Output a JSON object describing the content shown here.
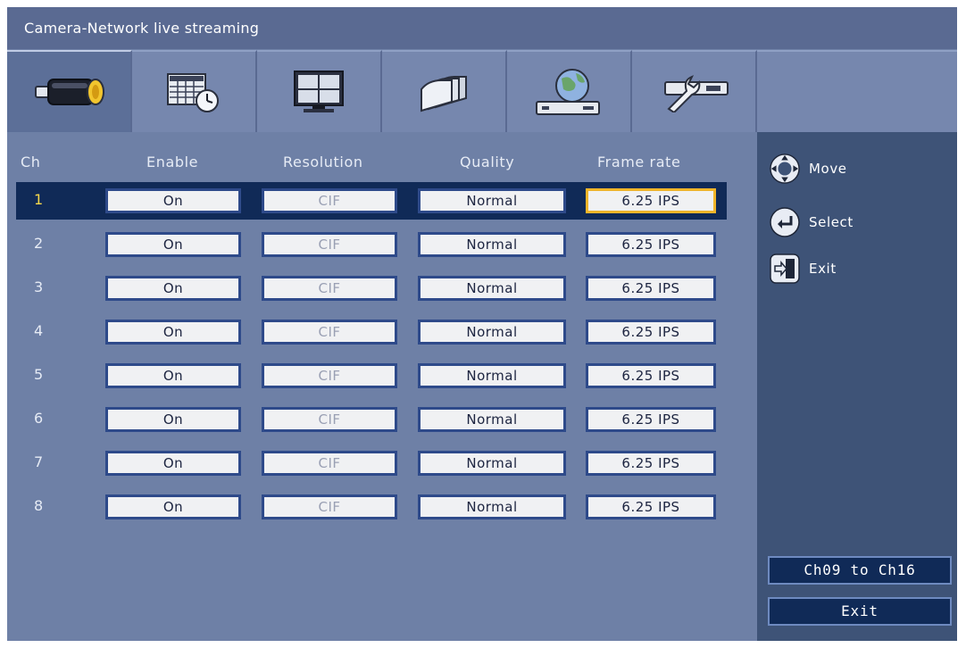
{
  "window": {
    "title": "Camera-Network live streaming"
  },
  "tabs": [
    {
      "icon": "camera-icon",
      "active": true
    },
    {
      "icon": "schedule-icon",
      "active": false
    },
    {
      "icon": "monitor-icon",
      "active": false
    },
    {
      "icon": "disk-stack-icon",
      "active": false
    },
    {
      "icon": "network-globe-icon",
      "active": false
    },
    {
      "icon": "tools-icon",
      "active": false
    }
  ],
  "table": {
    "headers": {
      "ch": "Ch",
      "enable": "Enable",
      "resolution": "Resolution",
      "quality": "Quality",
      "frame_rate": "Frame rate"
    },
    "rows": [
      {
        "ch": "1",
        "enable": "On",
        "resolution": "CIF",
        "quality": "Normal",
        "frame_rate": "6.25 IPS"
      },
      {
        "ch": "2",
        "enable": "On",
        "resolution": "CIF",
        "quality": "Normal",
        "frame_rate": "6.25 IPS"
      },
      {
        "ch": "3",
        "enable": "On",
        "resolution": "CIF",
        "quality": "Normal",
        "frame_rate": "6.25 IPS"
      },
      {
        "ch": "4",
        "enable": "On",
        "resolution": "CIF",
        "quality": "Normal",
        "frame_rate": "6.25 IPS"
      },
      {
        "ch": "5",
        "enable": "On",
        "resolution": "CIF",
        "quality": "Normal",
        "frame_rate": "6.25 IPS"
      },
      {
        "ch": "6",
        "enable": "On",
        "resolution": "CIF",
        "quality": "Normal",
        "frame_rate": "6.25 IPS"
      },
      {
        "ch": "7",
        "enable": "On",
        "resolution": "CIF",
        "quality": "Normal",
        "frame_rate": "6.25 IPS"
      },
      {
        "ch": "8",
        "enable": "On",
        "resolution": "CIF",
        "quality": "Normal",
        "frame_rate": "6.25 IPS"
      }
    ]
  },
  "legend": {
    "move": "Move",
    "select": "Select",
    "exit": "Exit"
  },
  "buttons": {
    "next_channels": "Ch09 to Ch16",
    "exit": "Exit"
  },
  "colors": {
    "selected_row": "#102a57",
    "focus_border": "#f0b52a",
    "selected_ch_text": "#f7d84b"
  }
}
